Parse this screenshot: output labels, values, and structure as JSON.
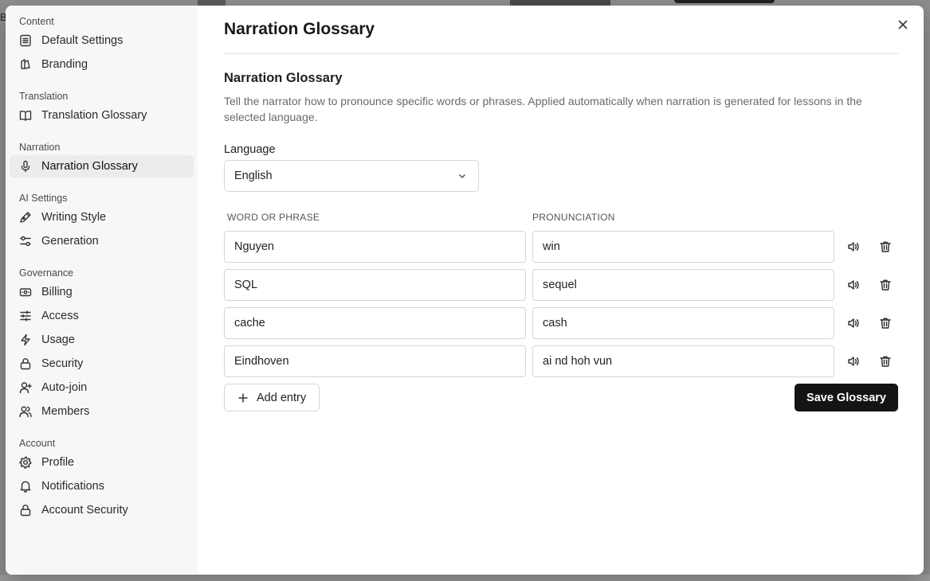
{
  "sidebar": {
    "groups": [
      {
        "title": "Content",
        "items": [
          {
            "label": "Default Settings",
            "icon": "list-icon"
          },
          {
            "label": "Branding",
            "icon": "palette-icon"
          }
        ]
      },
      {
        "title": "Translation",
        "items": [
          {
            "label": "Translation Glossary",
            "icon": "book-icon"
          }
        ]
      },
      {
        "title": "Narration",
        "items": [
          {
            "label": "Narration Glossary",
            "icon": "microphone-icon",
            "active": true
          }
        ]
      },
      {
        "title": "AI Settings",
        "items": [
          {
            "label": "Writing Style",
            "icon": "pen-icon"
          },
          {
            "label": "Generation",
            "icon": "sliders-icon"
          }
        ]
      },
      {
        "title": "Governance",
        "items": [
          {
            "label": "Billing",
            "icon": "billing-icon"
          },
          {
            "label": "Access",
            "icon": "access-sliders-icon"
          },
          {
            "label": "Usage",
            "icon": "lightning-icon"
          },
          {
            "label": "Security",
            "icon": "lock-icon"
          },
          {
            "label": "Auto-join",
            "icon": "user-plus-icon"
          },
          {
            "label": "Members",
            "icon": "users-icon"
          }
        ]
      },
      {
        "title": "Account",
        "items": [
          {
            "label": "Profile",
            "icon": "gear-icon"
          },
          {
            "label": "Notifications",
            "icon": "bell-icon"
          },
          {
            "label": "Account Security",
            "icon": "lock-icon"
          }
        ]
      }
    ]
  },
  "main": {
    "title": "Narration Glossary",
    "section_heading": "Narration Glossary",
    "description": "Tell the narrator how to pronounce specific words or phrases. Applied automatically when narration is generated for lessons in the selected language.",
    "language_label": "Language",
    "language_value": "English",
    "col_word": "WORD OR PHRASE",
    "col_pronunciation": "PRONUNCIATION",
    "entries": [
      {
        "word": "Nguyen",
        "pronunciation": "win"
      },
      {
        "word": "SQL",
        "pronunciation": "sequel"
      },
      {
        "word": "cache",
        "pronunciation": "cash"
      },
      {
        "word": "Eindhoven",
        "pronunciation": "ai nd hoh vun"
      }
    ],
    "add_label": "Add entry",
    "save_label": "Save Glossary"
  },
  "backdrop": {
    "letter": "B"
  }
}
